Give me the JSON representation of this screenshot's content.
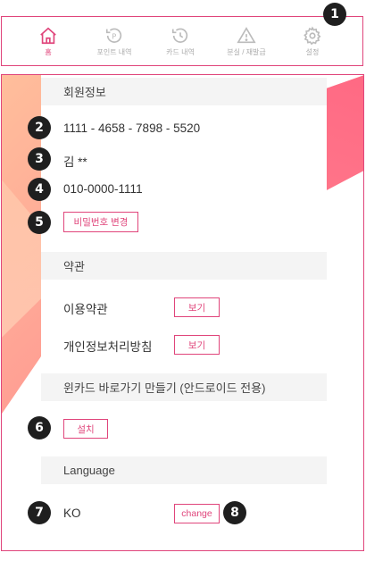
{
  "nav": {
    "items": [
      {
        "label": "홈"
      },
      {
        "label": "포인트 내역"
      },
      {
        "label": "카드 내역"
      },
      {
        "label": "분실 / 재발급"
      },
      {
        "label": "설정"
      }
    ]
  },
  "badges": [
    "1",
    "2",
    "3",
    "4",
    "5",
    "6",
    "7",
    "8"
  ],
  "member": {
    "heading": "회원정보",
    "card_number": "1111 - 4658 - 7898 - 5520",
    "name": "김 **",
    "phone": "010-0000-1111",
    "change_password_label": "비밀번호 변경"
  },
  "terms": {
    "heading": "약관",
    "terms_of_use": "이용약관",
    "privacy_policy": "개인정보처리방침",
    "view_label": "보기"
  },
  "shortcut": {
    "heading": "윈카드 바로가기 만들기 (안드로이드 전용)",
    "install_label": "설치"
  },
  "language": {
    "heading": "Language",
    "current": "KO",
    "change_label": "change"
  },
  "colors": {
    "accent": "#e0457b",
    "badge": "#1f1f1f"
  }
}
